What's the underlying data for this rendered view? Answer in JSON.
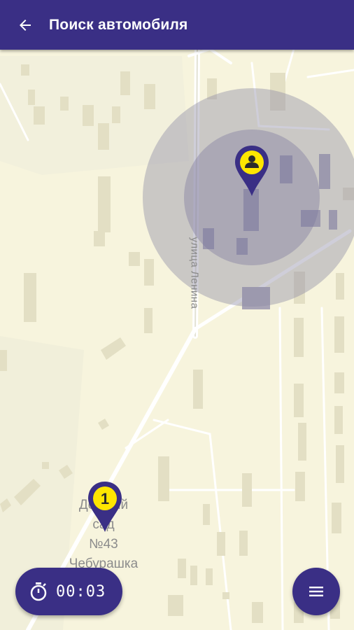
{
  "header": {
    "title": "Поиск автомобиля",
    "back_icon": "arrow-left-icon"
  },
  "map": {
    "street_name": "улица Ленина",
    "poi_lines": [
      "Детский",
      "сад",
      "№43",
      "Чебурашка"
    ],
    "car_marker_number": "1",
    "user_marker_icon": "person-icon"
  },
  "timer": {
    "icon": "stopwatch-icon",
    "value": "00:03"
  },
  "menu_button": {
    "icon": "menu-icon"
  },
  "colors": {
    "primary": "#3a2f85",
    "accent": "#ffe600",
    "map_bg": "#f7f4dd"
  }
}
